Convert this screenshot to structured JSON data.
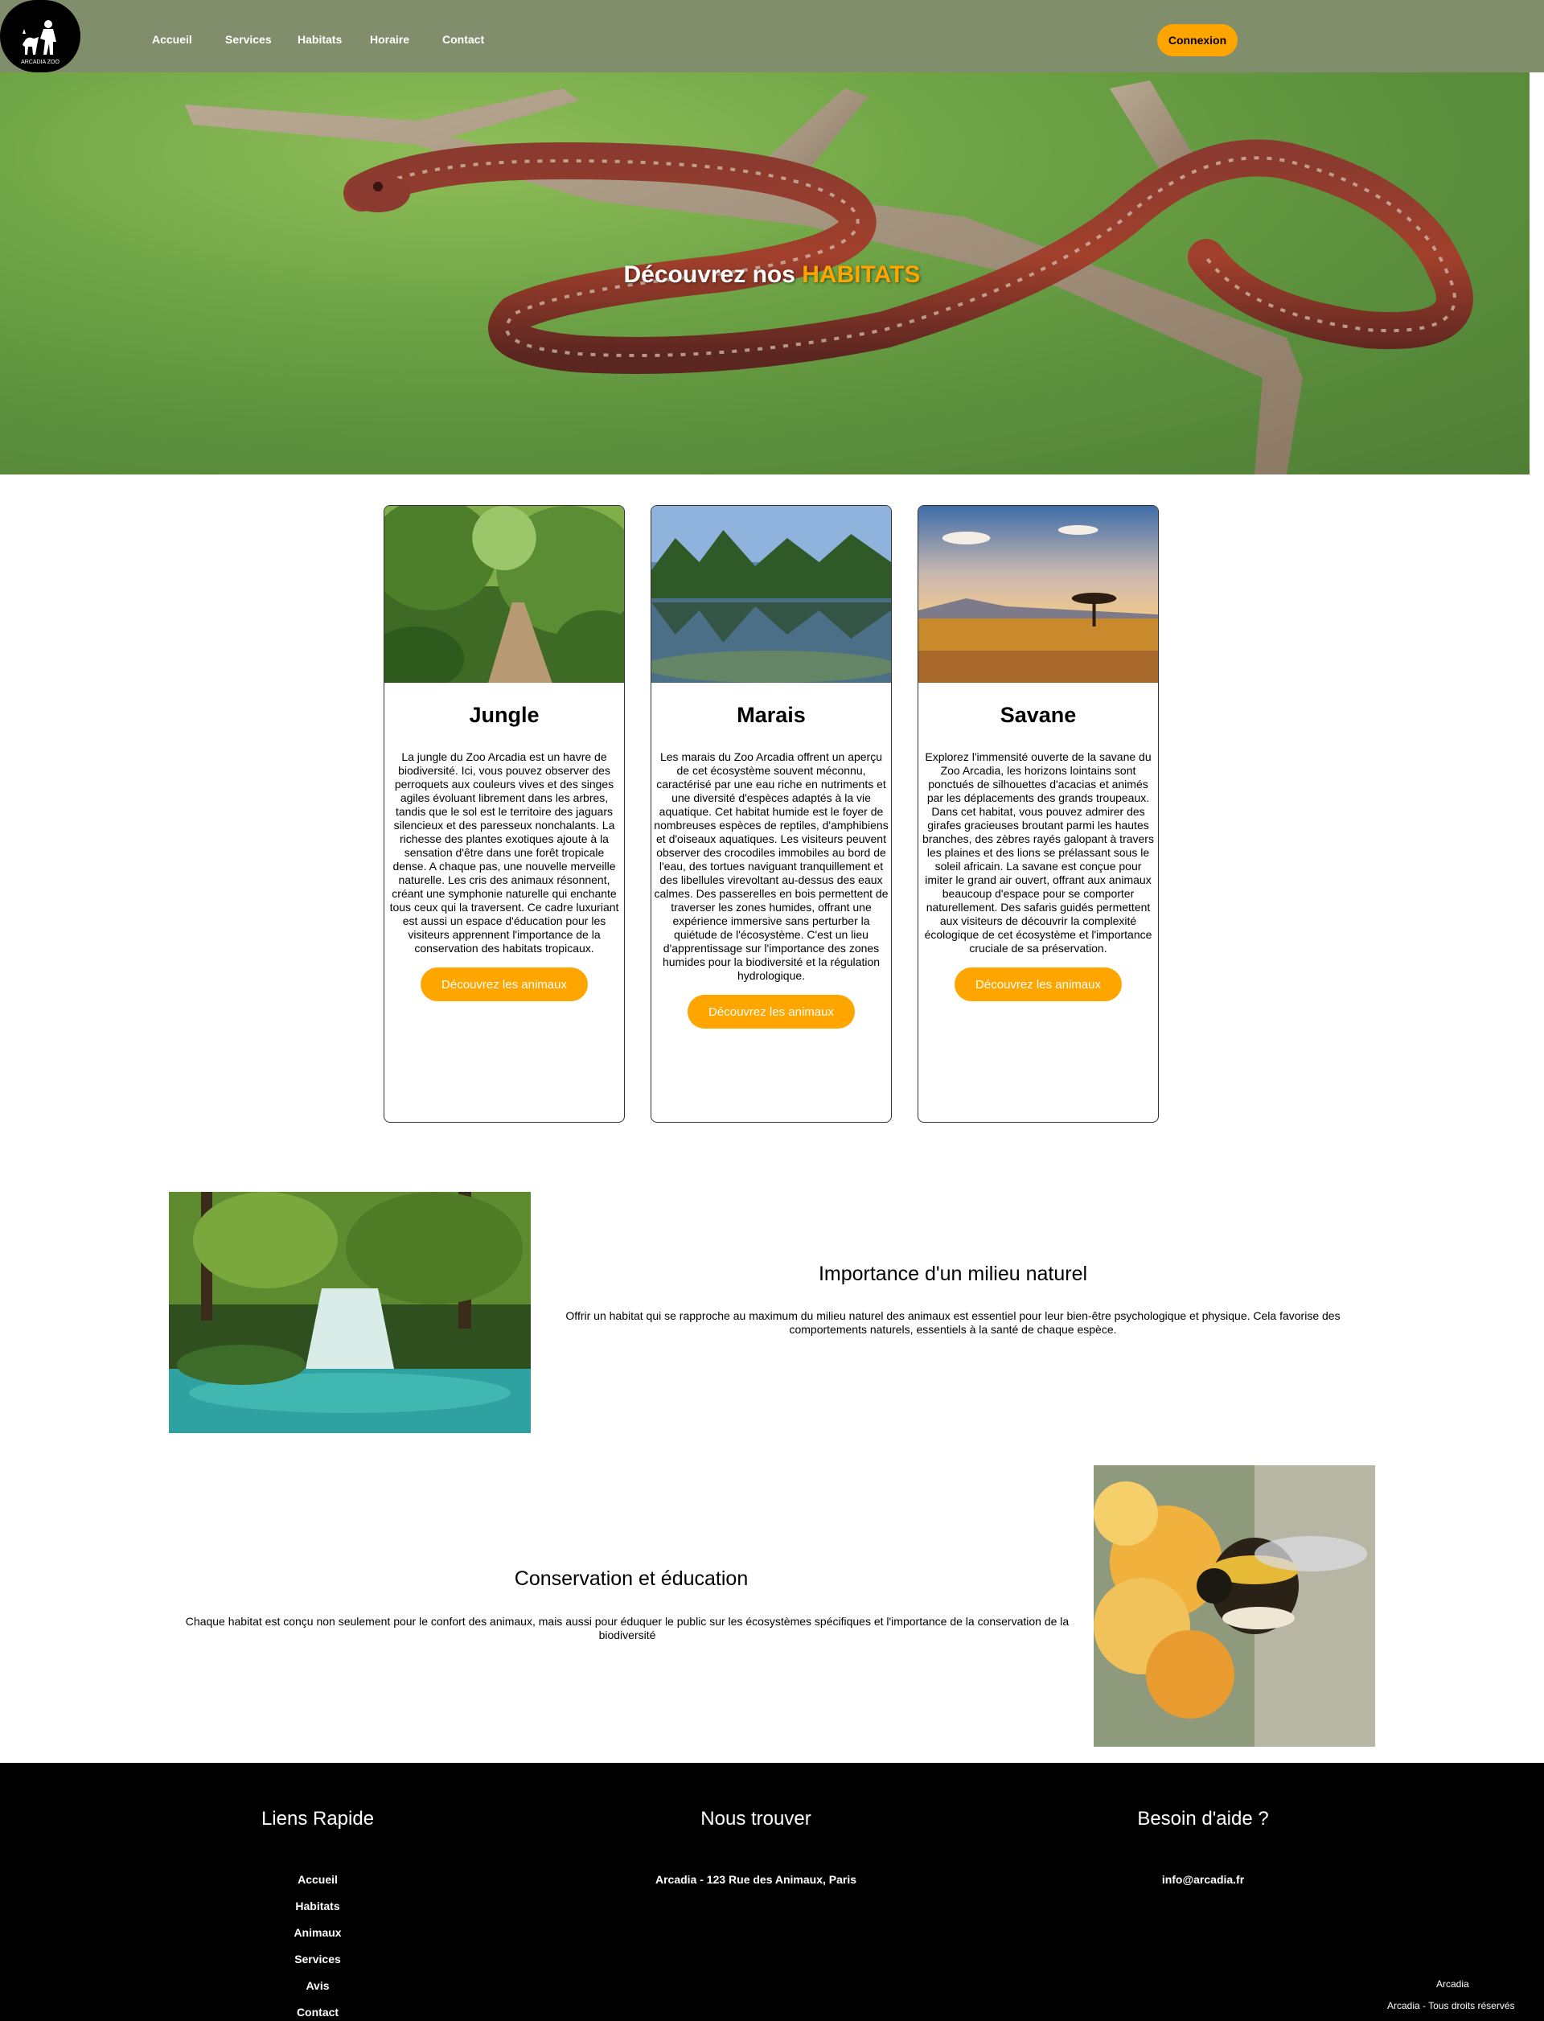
{
  "header": {
    "logo_text": "ARCADIA ZOO",
    "nav": [
      "Accueil",
      "Services",
      "Habitats",
      "Horaire",
      "Contact"
    ],
    "login_label": "Connexion"
  },
  "hero": {
    "title_prefix": "Découvrez nos",
    "title_highlight": "HABITATS"
  },
  "habitats": [
    {
      "title": "Jungle",
      "text": "La jungle du Zoo Arcadia est un havre de biodiversité. Ici, vous pouvez observer des perroquets aux couleurs vives et des singes agiles évoluant librement dans les arbres, tandis que le sol est le territoire des jaguars silencieux et des paresseux nonchalants. La richesse des plantes exotiques ajoute à la sensation d'être dans une forêt tropicale dense. A chaque pas, une nouvelle merveille naturelle. Les cris des animaux résonnent, créant une symphonie naturelle qui enchante tous ceux qui la traversent. Ce cadre luxuriant est aussi un espace d'éducation pour les visiteurs apprennent l'importance de la conservation des habitats tropicaux.",
      "button": "Découvrez les animaux"
    },
    {
      "title": "Marais",
      "text": "Les marais du Zoo Arcadia offrent un aperçu de cet écosystème souvent méconnu, caractérisé par une eau riche en nutriments et une diversité d'espèces adaptés à la vie aquatique. Cet habitat humide est le foyer de nombreuses espèces de reptiles, d'amphibiens et d'oiseaux aquatiques. Les visiteurs peuvent observer des crocodiles immobiles au bord de l'eau, des tortues naviguant tranquillement et des libellules virevoltant au-dessus des eaux calmes. Des passerelles en bois permettent de traverser les zones humides, offrant une expérience immersive sans perturber la quiétude de l'écosystème. C'est un lieu d'apprentissage sur l'importance des zones humides pour la biodiversité et la régulation hydrologique.",
      "button": "Découvrez les animaux"
    },
    {
      "title": "Savane",
      "text": "Explorez l'immensité ouverte de la savane du Zoo Arcadia, les horizons lointains sont ponctués de silhouettes d'acacias et animés par les déplacements des grands troupeaux. Dans cet habitat, vous pouvez admirer des girafes gracieuses broutant parmi les hautes branches, des zèbres rayés galopant à travers les plaines et des lions se prélassant sous le soleil africain. La savane est conçue pour imiter le grand air ouvert, offrant aux animaux beaucoup d'espace pour se comporter naturellement. Des safaris guidés permettent aux visiteurs de découvrir la complexité écologique de cet écosystème et l'importance cruciale de sa préservation.",
      "button": "Découvrez les animaux"
    }
  ],
  "sections": {
    "milieu": {
      "title": "Importance d'un milieu naturel",
      "text": "Offrir un habitat qui se rapproche au maximum du milieu naturel des animaux est essentiel pour leur bien-être psychologique et physique. Cela favorise des comportements naturels, essentiels à la santé de chaque espèce."
    },
    "conservation": {
      "title": "Conservation et éducation",
      "text": "Chaque habitat est conçu non seulement pour le confort des animaux, mais aussi pour éduquer le public sur les écosystèmes spécifiques et l'importance de la conservation de la biodiversité"
    }
  },
  "footer": {
    "links_heading": "Liens Rapide",
    "links": [
      "Accueil",
      "Habitats",
      "Animaux",
      "Services",
      "Avis",
      "Contact"
    ],
    "find_heading": "Nous trouver",
    "address": "Arcadia - 123 Rue des Animaux, Paris",
    "help_heading": "Besoin d'aide ?",
    "email": "info@arcadia.fr",
    "brand": "Arcadia",
    "copyright": "Arcadia - Tous droits réservés"
  },
  "colors": {
    "header_bg": "#808e6c",
    "accent": "#ffa500",
    "footer_bg": "#000000"
  }
}
